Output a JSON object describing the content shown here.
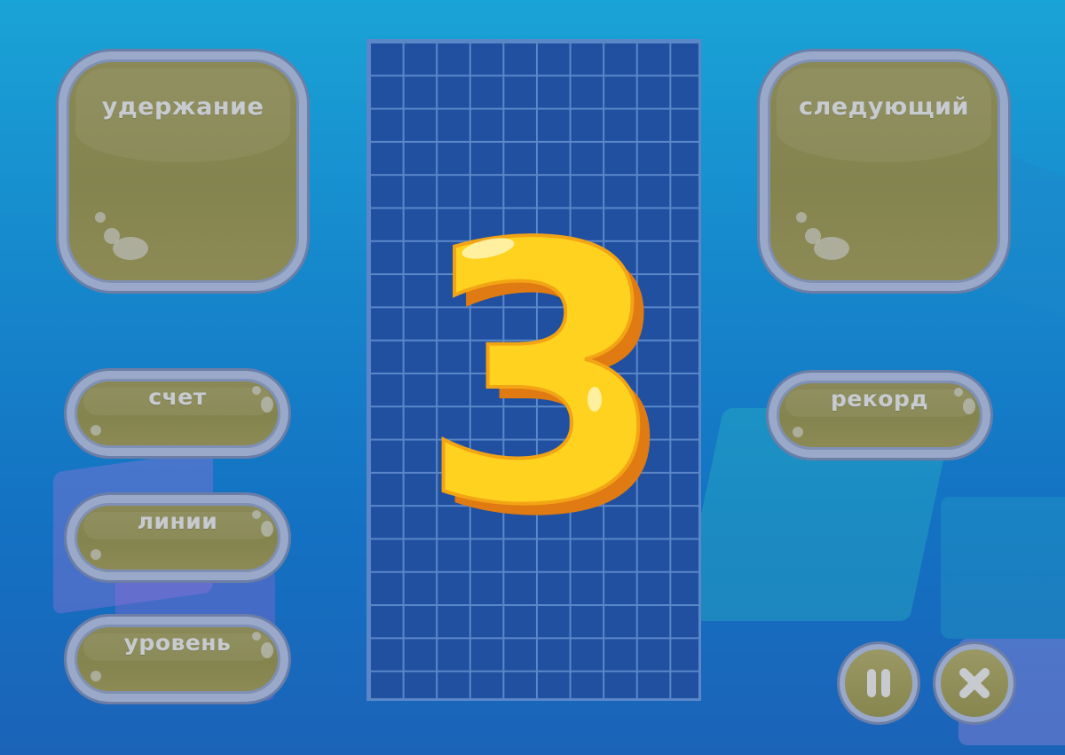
{
  "panels": {
    "hold": {
      "label": "удержание"
    },
    "next": {
      "label": "следующий"
    },
    "score": {
      "label": "счет"
    },
    "lines": {
      "label": "линии"
    },
    "level": {
      "label": "уровень"
    },
    "record": {
      "label": "рекорд"
    }
  },
  "countdown": {
    "value": "3"
  },
  "buttons": {
    "pause_icon": "pause-icon",
    "close_icon": "close-icon"
  },
  "colors": {
    "background": "#1688cc",
    "panel": "#8a8957",
    "panel_border": "#9aa9c9",
    "grid": "#20509f",
    "grid_line": "#5b87c9",
    "countdown": "#ffd21f"
  }
}
